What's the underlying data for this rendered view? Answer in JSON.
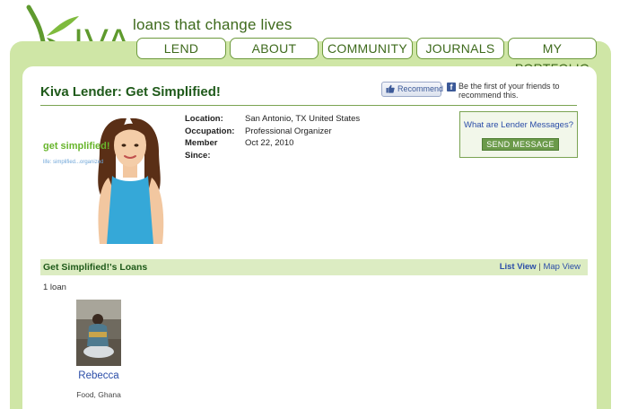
{
  "header": {
    "logo_text": "KIVA",
    "tagline": "loans that change lives",
    "nav": [
      {
        "label": "LEND"
      },
      {
        "label": "ABOUT"
      },
      {
        "label": "COMMUNITY"
      },
      {
        "label": "JOURNALS"
      },
      {
        "label": "MY PORTFOLIO"
      }
    ]
  },
  "page": {
    "title": "Kiva Lender: Get Simplified!",
    "recommend_button": "Recommend",
    "fb_logo": "f",
    "fb_text": "Be the first of your friends to recommend this."
  },
  "profile": {
    "image_title": "get simplified!",
    "image_subtitle": "life: simplified...organized",
    "details": [
      {
        "label": "Location:",
        "value": "San Antonio, TX United States"
      },
      {
        "label": "Occupation:",
        "value": "Professional Organizer"
      },
      {
        "label": "Member Since:",
        "value": "Oct 22, 2010"
      }
    ]
  },
  "messages": {
    "link": "What are Lender Messages?",
    "button": "SEND MESSAGE"
  },
  "loans": {
    "section_title": "Get Simplified!'s Loans",
    "list_view": "List View",
    "separator": "|",
    "map_view": "Map View",
    "count": "1 loan",
    "items": [
      {
        "name": "Rebecca",
        "meta": "Food, Ghana"
      }
    ]
  },
  "colors": {
    "brand_green": "#3e6a1c",
    "band_green": "#cfe6a6",
    "link_blue": "#2b4da8"
  }
}
